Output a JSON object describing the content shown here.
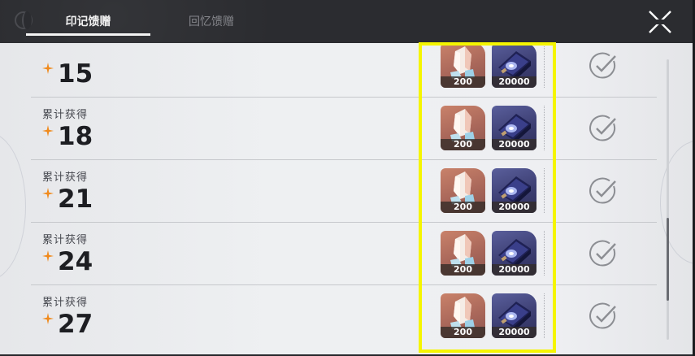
{
  "tabs": [
    {
      "label": "印记馈赠",
      "active": true
    },
    {
      "label": "回忆馈赠",
      "active": false
    }
  ],
  "colors": {
    "highlight": "#f5f500",
    "star": "#f08a1d",
    "check": "#8c8e93"
  },
  "rows": [
    {
      "label": "",
      "count": "15",
      "rewards": [
        {
          "icon": "crystal-icon",
          "qty": "200"
        },
        {
          "icon": "credit-chip-icon",
          "qty": "20000"
        }
      ],
      "claimed": true
    },
    {
      "label": "累计获得",
      "count": "18",
      "rewards": [
        {
          "icon": "crystal-icon",
          "qty": "200"
        },
        {
          "icon": "credit-chip-icon",
          "qty": "20000"
        }
      ],
      "claimed": true
    },
    {
      "label": "累计获得",
      "count": "21",
      "rewards": [
        {
          "icon": "crystal-icon",
          "qty": "200"
        },
        {
          "icon": "credit-chip-icon",
          "qty": "20000"
        }
      ],
      "claimed": true
    },
    {
      "label": "累计获得",
      "count": "24",
      "rewards": [
        {
          "icon": "crystal-icon",
          "qty": "200"
        },
        {
          "icon": "credit-chip-icon",
          "qty": "20000"
        }
      ],
      "claimed": true
    },
    {
      "label": "累计获得",
      "count": "27",
      "rewards": [
        {
          "icon": "crystal-icon",
          "qty": "200"
        },
        {
          "icon": "credit-chip-icon",
          "qty": "20000"
        }
      ],
      "claimed": true
    }
  ]
}
